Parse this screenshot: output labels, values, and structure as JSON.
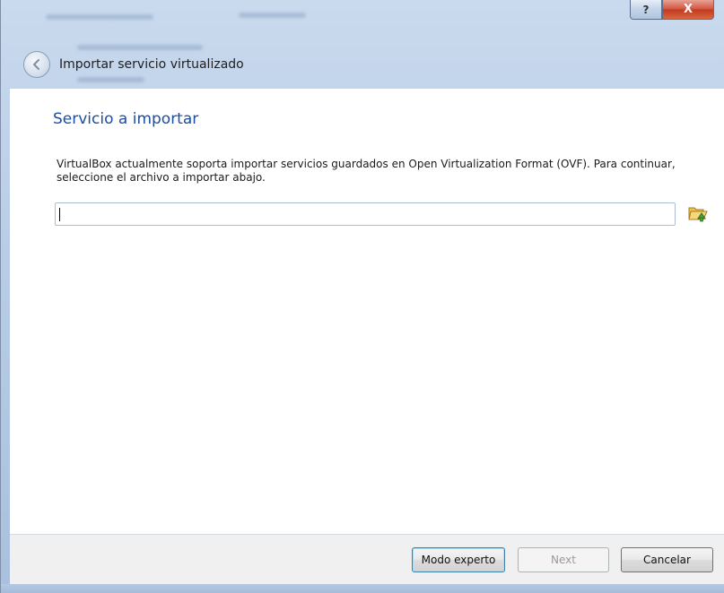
{
  "window": {
    "help_label": "?",
    "close_label": "X"
  },
  "header": {
    "title": "Importar servicio virtualizado"
  },
  "page": {
    "title": "Servicio a importar",
    "description": "VirtualBox actualmente soporta importar servicios guardados en Open Virtualization Format (OVF). Para continuar, seleccione el archivo a importar abajo.",
    "file_value": "",
    "file_placeholder": ""
  },
  "footer": {
    "expert_label": "Modo experto",
    "next_label": "Next",
    "cancel_label": "Cancelar"
  },
  "icons": {
    "back": "back-arrow-icon",
    "folder": "open-folder-icon"
  },
  "colors": {
    "title_blue": "#1b4ea3",
    "close_red": "#c23a22"
  }
}
